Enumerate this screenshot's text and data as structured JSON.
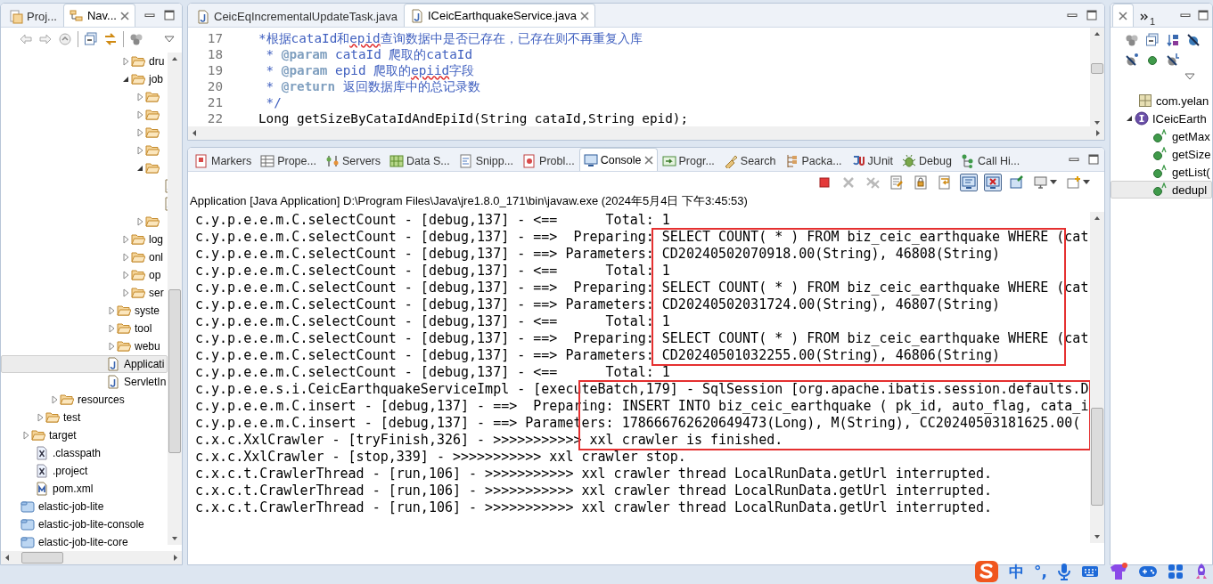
{
  "navigator": {
    "tabs": [
      {
        "label": "Proj...",
        "selected": false
      },
      {
        "label": "Nav...",
        "selected": true
      }
    ],
    "tree": [
      {
        "children": [
          {
            "children": [
              {
                "children": [
                  {
                    "children": [
                      {
                        "children": [
                          {
                            "children": [
                              {
                                "children": [
                                  {
                                    "children": [
                                      {
                                        "kind": "folder",
                                        "label": "dru",
                                        "expanded": false,
                                        "selected": false
                                      },
                                      {
                                        "kind": "folder",
                                        "label": "job",
                                        "expanded": true,
                                        "selected": false,
                                        "children": [
                                          {
                                            "kind": "folder",
                                            "expanded": false,
                                            "selected": false
                                          },
                                          {
                                            "kind": "folder",
                                            "expanded": false,
                                            "selected": false
                                          },
                                          {
                                            "kind": "folder",
                                            "expanded": false,
                                            "selected": false
                                          },
                                          {
                                            "kind": "folder",
                                            "expanded": false,
                                            "selected": false
                                          },
                                          {
                                            "kind": "folder",
                                            "expanded": true,
                                            "selected": false,
                                            "children": [
                                              {
                                                "kind": "java",
                                                "selected": false
                                              },
                                              {
                                                "kind": "java",
                                                "selected": false
                                              }
                                            ]
                                          },
                                          {
                                            "kind": "folder",
                                            "expanded": false,
                                            "selected": false
                                          }
                                        ]
                                      },
                                      {
                                        "kind": "folder",
                                        "label": "log",
                                        "expanded": false,
                                        "selected": false
                                      },
                                      {
                                        "kind": "folder",
                                        "label": "onl",
                                        "expanded": false,
                                        "selected": false
                                      },
                                      {
                                        "kind": "folder",
                                        "label": "op",
                                        "expanded": false,
                                        "selected": false
                                      },
                                      {
                                        "kind": "folder",
                                        "label": "ser",
                                        "expanded": false,
                                        "selected": false
                                      }
                                    ]
                                  },
                                  {
                                    "kind": "folder",
                                    "label": "syste",
                                    "expanded": false,
                                    "selected": false
                                  },
                                  {
                                    "kind": "folder",
                                    "label": "tool",
                                    "expanded": false,
                                    "selected": false
                                  },
                                  {
                                    "kind": "folder",
                                    "label": "webu",
                                    "expanded": false,
                                    "selected": false
                                  }
                                ]
                              },
                              {
                                "kind": "java",
                                "label": "Applicati",
                                "selected": true
                              },
                              {
                                "kind": "java",
                                "label": "ServletIn",
                                "selected": false
                              }
                            ]
                          }
                        ]
                      }
                    ]
                  },
                  {
                    "kind": "folder",
                    "label": "resources",
                    "expanded": false,
                    "selected": false
                  }
                ]
              },
              {
                "kind": "folder",
                "label": "test",
                "expanded": false,
                "selected": false
              }
            ]
          },
          {
            "kind": "folder",
            "label": "target",
            "expanded": false,
            "selected": false
          },
          {
            "kind": "xml",
            "label": ".classpath",
            "selected": false
          },
          {
            "kind": "xml",
            "label": ".project",
            "selected": false
          },
          {
            "kind": "maven",
            "label": "pom.xml",
            "selected": false
          }
        ]
      },
      {
        "kind": "project",
        "label": "elastic-job-lite",
        "selected": false
      },
      {
        "kind": "project",
        "label": "elastic-job-lite-console",
        "selected": false
      },
      {
        "kind": "project",
        "label": "elastic-job-lite-core",
        "selected": false
      }
    ]
  },
  "editor": {
    "tabs": [
      {
        "label": "CeicEqIncrementalUpdateTask.java",
        "selected": false
      },
      {
        "label": "ICeicEarthquakeService.java",
        "selected": true
      }
    ],
    "lines": [
      {
        "number": "17",
        "segments": [
          {
            "text": "*根据cataId和",
            "kind": "comment"
          },
          {
            "text": "epid",
            "kind": "misspelled"
          },
          {
            "text": "查询数据中是否已存在，已存在则不再重复入库",
            "kind": "comment"
          }
        ]
      },
      {
        "number": "18",
        "segments": [
          {
            "text": " * ",
            "kind": "comment"
          },
          {
            "text": "@param",
            "kind": "tag"
          },
          {
            "text": " cataId 爬取的cataId",
            "kind": "comment"
          }
        ]
      },
      {
        "number": "19",
        "segments": [
          {
            "text": " * ",
            "kind": "comment"
          },
          {
            "text": "@param",
            "kind": "tag"
          },
          {
            "text": " epid 爬取的",
            "kind": "comment"
          },
          {
            "text": "epiid",
            "kind": "misspelled"
          },
          {
            "text": "字段",
            "kind": "comment"
          }
        ]
      },
      {
        "number": "20",
        "segments": [
          {
            "text": " * ",
            "kind": "comment"
          },
          {
            "text": "@return",
            "kind": "tag"
          },
          {
            "text": " 返回数据库中的总记录数",
            "kind": "comment"
          }
        ]
      },
      {
        "number": "21",
        "segments": [
          {
            "text": " */",
            "kind": "comment"
          }
        ]
      },
      {
        "number": "22",
        "segments": [
          {
            "text": "Long getSizeByCataIdAndEpiId(String cataId,String epid);",
            "kind": "code"
          }
        ]
      }
    ]
  },
  "console": {
    "tabs": [
      {
        "label": "Markers",
        "selected": false
      },
      {
        "label": "Prope...",
        "selected": false
      },
      {
        "label": "Servers",
        "selected": false
      },
      {
        "label": "Data S...",
        "selected": false
      },
      {
        "label": "Snipp...",
        "selected": false
      },
      {
        "label": "Probl...",
        "selected": false
      },
      {
        "label": "Console",
        "selected": true
      },
      {
        "label": "Progr...",
        "selected": false
      },
      {
        "label": "Search",
        "selected": false
      },
      {
        "label": "Packa...",
        "selected": false
      },
      {
        "label": "JUnit",
        "selected": false
      },
      {
        "label": "Debug",
        "selected": false
      },
      {
        "label": "Call Hi...",
        "selected": false
      }
    ],
    "toolbar": [
      {
        "kind": "terminate",
        "disabled": false,
        "pressed": false
      },
      {
        "kind": "remove",
        "disabled": true,
        "pressed": false
      },
      {
        "kind": "remove-all",
        "disabled": true,
        "pressed": false
      },
      {
        "kind": "clear",
        "disabled": false,
        "pressed": false
      },
      {
        "kind": "scroll-lock",
        "disabled": false,
        "pressed": false
      },
      {
        "kind": "word-wrap",
        "disabled": false,
        "pressed": false
      },
      {
        "kind": "output",
        "disabled": false,
        "pressed": true
      },
      {
        "kind": "error",
        "disabled": false,
        "pressed": true
      },
      {
        "kind": "pin",
        "disabled": false,
        "pressed": false
      },
      {
        "kind": "display",
        "disabled": false,
        "pressed": false
      },
      {
        "kind": "new-console",
        "disabled": false,
        "pressed": false
      }
    ],
    "process": "Application [Java Application] D:\\Program Files\\Java\\jre1.8.0_171\\bin\\javaw.exe (2024年5月4日 下午3:45:53)",
    "lines": [
      {
        "kind": "text",
        "text": "c.y.p.e.e.m.C.selectCount - [debug,137] - <==      Total: 1"
      },
      {
        "kind": "highlight",
        "lines": [
          {
            "text": "c.y.p.e.e.m.C.selectCount - [debug,137] - ==>  Preparing: SELECT COUNT( * ) FROM biz_ceic_earthquake WHERE (cat"
          },
          {
            "text": "c.y.p.e.e.m.C.selectCount - [debug,137] - ==> Parameters: CD20240502070918.00(String), 46808(String)"
          },
          {
            "text": "c.y.p.e.e.m.C.selectCount - [debug,137] - <==      Total: 1"
          },
          {
            "text": "c.y.p.e.e.m.C.selectCount - [debug,137] - ==>  Preparing: SELECT COUNT( * ) FROM biz_ceic_earthquake WHERE (cat"
          },
          {
            "text": "c.y.p.e.e.m.C.selectCount - [debug,137] - ==> Parameters: CD20240502031724.00(String), 46807(String)"
          },
          {
            "text": "c.y.p.e.e.m.C.selectCount - [debug,137] - <==      Total: 1"
          },
          {
            "text": "c.y.p.e.e.m.C.selectCount - [debug,137] - ==>  Preparing: SELECT COUNT( * ) FROM biz_ceic_earthquake WHERE (cat"
          },
          {
            "text": "c.y.p.e.e.m.C.selectCount - [debug,137] - ==> Parameters: CD20240501032255.00(String), 46806(String)"
          }
        ]
      },
      {
        "kind": "text",
        "text": "c.y.p.e.e.m.C.selectCount - [debug,137] - <==      Total: 1"
      },
      {
        "kind": "highlight",
        "lines": [
          {
            "text": "c.y.p.e.e.s.i.CeicEarthquakeServiceImpl - [executeBatch,179] - SqlSession [org.apache.ibatis.session.defaults.D"
          },
          {
            "text": "c.y.p.e.e.m.C.insert - [debug,137] - ==>  Preparing: INSERT INTO biz_ceic_earthquake ( pk_id, auto_flag, cata_i"
          },
          {
            "text": "c.y.p.e.e.m.C.insert - [debug,137] - ==> Parameters: 178666762620649473(Long), M(String), CC20240503181625.00("
          },
          {
            "text": "c.x.c.XxlCrawler - [tryFinish,326] - >>>>>>>>>>> xxl crawler is finished."
          }
        ]
      },
      {
        "kind": "text",
        "text": "c.x.c.XxlCrawler - [stop,339] - >>>>>>>>>>> xxl crawler stop."
      },
      {
        "kind": "text",
        "text": "c.x.c.t.CrawlerThread - [run,106] - >>>>>>>>>>> xxl crawler thread LocalRunData.getUrl interrupted."
      },
      {
        "kind": "text",
        "text": "c.x.c.t.CrawlerThread - [run,106] - >>>>>>>>>>> xxl crawler thread LocalRunData.getUrl interrupted."
      },
      {
        "kind": "text",
        "text": "c.x.c.t.CrawlerThread - [run,106] - >>>>>>>>>>> xxl crawler thread LocalRunData.getUrl interrupted."
      }
    ]
  },
  "outline": {
    "tabs": [
      {
        "selected": true
      },
      {
        "overflow_count": "1",
        "selected": false
      }
    ],
    "tree": [
      {
        "kind": "package",
        "label": "com.yelan",
        "selected": false
      },
      {
        "kind": "interface",
        "label": "ICeicEarth",
        "expanded": true,
        "selected": false,
        "children": [
          {
            "kind": "method",
            "label": "getMax",
            "selected": false
          },
          {
            "kind": "method",
            "label": "getSize",
            "selected": false
          },
          {
            "kind": "method",
            "label": "getList(",
            "selected": false
          },
          {
            "kind": "method",
            "label": "dedupl",
            "selected": true
          }
        ]
      }
    ]
  },
  "input_method": {
    "items": [
      {
        "kind": "logo"
      },
      {
        "kind": "label",
        "text": "中"
      },
      {
        "kind": "label",
        "text": "°,"
      },
      {
        "kind": "mic"
      },
      {
        "kind": "keyboard"
      },
      {
        "kind": "skin"
      },
      {
        "kind": "game"
      },
      {
        "kind": "apps"
      },
      {
        "kind": "assistant"
      }
    ]
  }
}
